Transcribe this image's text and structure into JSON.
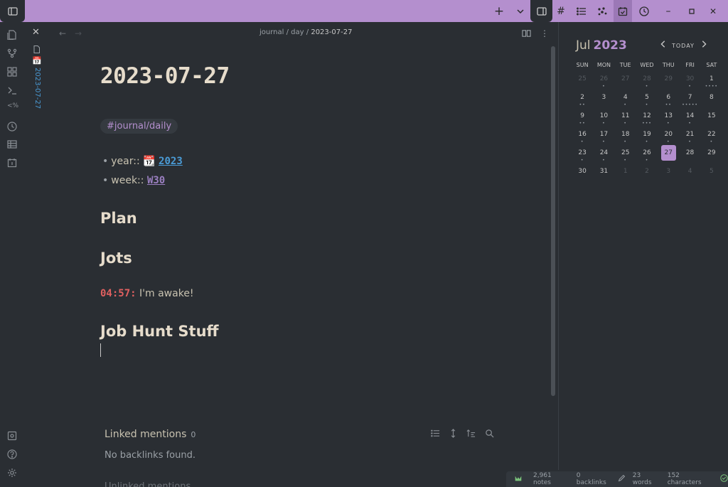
{
  "topbar": {
    "icons": [
      "sidebar-toggle-icon",
      "new-tab-icon",
      "chevron-down-icon",
      "right-sidebar-icon",
      "hashtag-icon",
      "list-icon",
      "graph-icon",
      "calendar-check-icon",
      "clock-icon",
      "minimize-icon",
      "maximize-icon",
      "close-icon"
    ],
    "new_tab": "+",
    "minimize": "–",
    "close": "✕"
  },
  "ribbon": {
    "icons": [
      "files-icon",
      "git-icon",
      "blocks-icon",
      "terminal-icon",
      "templater-icon",
      "history-icon",
      "table-icon",
      "calendar-icon",
      "vault-icon",
      "help-icon",
      "settings-icon"
    ],
    "templater_glyph": "<%"
  },
  "vtab": {
    "close": "✕",
    "label": "2023-07-27",
    "cal_emoji": "📅"
  },
  "editor": {
    "breadcrumb": [
      "journal",
      "day",
      "2023-07-27"
    ],
    "separator": "/",
    "title": "2023-07-27",
    "tag": "#journal/daily",
    "props": [
      {
        "key": "year::",
        "emoji": "📆",
        "value": "2023"
      },
      {
        "key": "week::",
        "value": "W30"
      }
    ],
    "headings": [
      "Plan",
      "Jots",
      "Job Hunt Stuff"
    ],
    "jot": {
      "time": "04:57:",
      "text": "I'm awake!"
    }
  },
  "linked_mentions": {
    "title": "Linked mentions",
    "count": "0",
    "empty": "No backlinks found.",
    "unlinked": "Unlinked mentions"
  },
  "calendar": {
    "month": "Jul",
    "year": "2023",
    "today_label": "TODAY",
    "weekdays": [
      "SUN",
      "MON",
      "TUE",
      "WED",
      "THU",
      "FRI",
      "SAT"
    ],
    "weeks": [
      [
        {
          "d": "25",
          "dim": true
        },
        {
          "d": "26",
          "dim": true,
          "dots": "•"
        },
        {
          "d": "27",
          "dim": true
        },
        {
          "d": "28",
          "dim": true,
          "dots": "•"
        },
        {
          "d": "29",
          "dim": true
        },
        {
          "d": "30",
          "dim": true,
          "dots": "•"
        },
        {
          "d": "1",
          "dots": "••••"
        }
      ],
      [
        {
          "d": "2",
          "dots": "••"
        },
        {
          "d": "3"
        },
        {
          "d": "4",
          "dots": "•"
        },
        {
          "d": "5",
          "dots": "•"
        },
        {
          "d": "6",
          "dots": "••"
        },
        {
          "d": "7",
          "dots": "•••••"
        },
        {
          "d": "8"
        }
      ],
      [
        {
          "d": "9",
          "dots": "••"
        },
        {
          "d": "10",
          "dots": "•"
        },
        {
          "d": "11",
          "dots": "•"
        },
        {
          "d": "12",
          "dots": "•••"
        },
        {
          "d": "13",
          "dots": "•"
        },
        {
          "d": "14",
          "dots": "•"
        },
        {
          "d": "15"
        }
      ],
      [
        {
          "d": "16",
          "dots": "•"
        },
        {
          "d": "17",
          "dots": "•"
        },
        {
          "d": "18",
          "dots": "•"
        },
        {
          "d": "19",
          "dots": "•"
        },
        {
          "d": "20",
          "dots": "•"
        },
        {
          "d": "21",
          "dots": "•"
        },
        {
          "d": "22",
          "dots": "•"
        }
      ],
      [
        {
          "d": "23",
          "dots": "•"
        },
        {
          "d": "24",
          "dots": "•"
        },
        {
          "d": "25",
          "dots": "•"
        },
        {
          "d": "26",
          "dots": "•"
        },
        {
          "d": "27",
          "today": true
        },
        {
          "d": "28"
        },
        {
          "d": "29"
        }
      ],
      [
        {
          "d": "30"
        },
        {
          "d": "31"
        },
        {
          "d": "1",
          "dim": true
        },
        {
          "d": "2",
          "dim": true
        },
        {
          "d": "3",
          "dim": true
        },
        {
          "d": "4",
          "dim": true
        },
        {
          "d": "5",
          "dim": true
        }
      ]
    ]
  },
  "status": {
    "notes": "2,961 notes",
    "backlinks": "0 backlinks",
    "words": "23 words",
    "chars": "152 characters"
  }
}
